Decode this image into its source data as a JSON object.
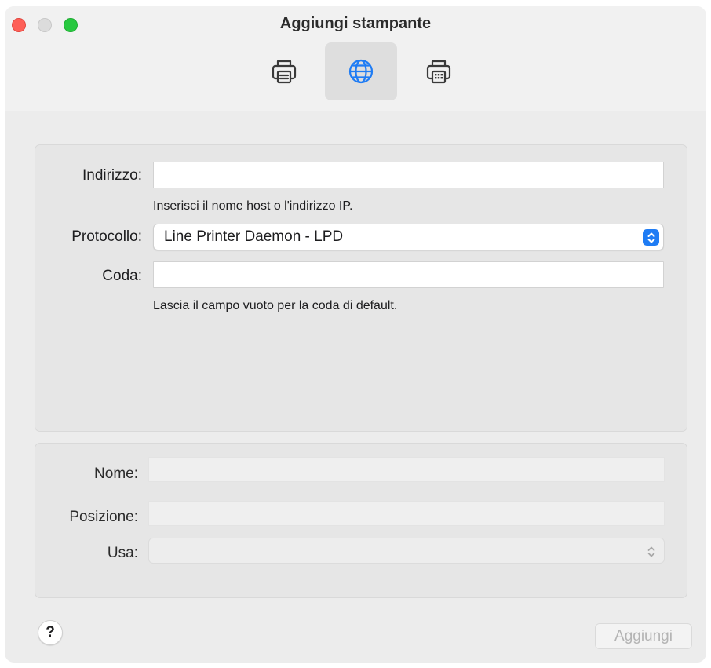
{
  "window": {
    "title": "Aggiungi stampante"
  },
  "toolbar": {
    "buttons": [
      {
        "name": "default",
        "icon": "printer-icon",
        "active": false
      },
      {
        "name": "ip",
        "icon": "globe-icon",
        "active": true
      },
      {
        "name": "windows",
        "icon": "fax-printer-icon",
        "active": false
      }
    ],
    "accent": "#1f7cf4"
  },
  "connection": {
    "address_label": "Indirizzo:",
    "address_value": "",
    "address_hint": "Inserisci il nome host o l'indirizzo IP.",
    "protocol_label": "Protocollo:",
    "protocol_value": "Line Printer Daemon - LPD",
    "queue_label": "Coda:",
    "queue_value": "",
    "queue_hint": "Lascia il campo vuoto per la coda di default."
  },
  "details": {
    "name_label": "Nome:",
    "name_value": "",
    "location_label": "Posizione:",
    "location_value": "",
    "use_label": "Usa:",
    "use_value": ""
  },
  "footer": {
    "help_label": "?",
    "add_label": "Aggiungi"
  }
}
